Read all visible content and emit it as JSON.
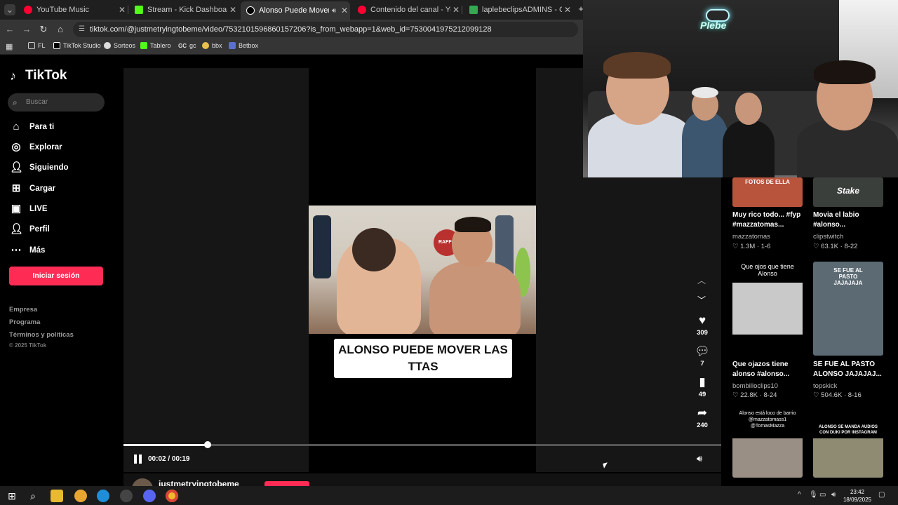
{
  "browser": {
    "tabs": [
      {
        "title": "YouTube Music",
        "color": "#ff0033"
      },
      {
        "title": "Stream - Kick Dashboard",
        "color": "#53fc18"
      },
      {
        "title": "Alonso Puede Mover Las Tt",
        "color": "#ffffff"
      },
      {
        "title": "Contenido del canal - YouTube",
        "color": "#ff0033"
      },
      {
        "title": "laplebeclipsADMINS - Google",
        "color": "#34a853"
      }
    ],
    "url": "tiktok.com/@justmetryingtobeme/video/7532101596860157206?is_from_webapp=1&web_id=7530041975212099128",
    "bookmarks": [
      "FL",
      "TikTok Studio",
      "Sorteos",
      "Tablero",
      "gc",
      "bbx",
      "Betbox"
    ]
  },
  "sidebar": {
    "logo": "TikTok",
    "search_placeholder": "Buscar",
    "nav": [
      {
        "label": "Para ti",
        "icon": "home-icon"
      },
      {
        "label": "Explorar",
        "icon": "compass-icon"
      },
      {
        "label": "Siguiendo",
        "icon": "user-follow-icon"
      },
      {
        "label": "Cargar",
        "icon": "upload-icon"
      },
      {
        "label": "LIVE",
        "icon": "live-icon"
      },
      {
        "label": "Perfil",
        "icon": "profile-icon"
      },
      {
        "label": "Más",
        "icon": "more-icon"
      }
    ],
    "login_label": "Iniciar sesión",
    "footer_links": [
      "Empresa",
      "Programa",
      "Términos y políticas"
    ],
    "copyright": "© 2025 TikTok"
  },
  "video": {
    "caption": "ALONSO PUEDE MOVER LAS TTAS",
    "poster_text": "RAFFO",
    "current_time": "00:02",
    "duration": "00:19",
    "progress": 0.1404,
    "likes": "309",
    "comments": "7",
    "saves": "49",
    "shares": "240",
    "author": "justmetryingtobeme"
  },
  "related": [
    {
      "overlay": "FOTOS DE ELLA",
      "title": "Muy rico todo... #fyp #mazzatomas...",
      "author": "mazzatomas",
      "views": "1.3M",
      "date": "1-6",
      "thumb": "#b8543c"
    },
    {
      "overlay": "Stake",
      "title": "Movia el labio #alonso...",
      "author": "clipstwitch",
      "views": "63.1K",
      "date": "8-22",
      "thumb": "#3b3f3c"
    },
    {
      "overlay": "Que ojos que tiene Alonso",
      "title": "Que ojazos tiene alonso #alonso...",
      "author": "bombilloclips10",
      "views": "22.8K",
      "date": "8-24",
      "thumb": "#c9c9c9"
    },
    {
      "overlay": "SE FUE AL PASTO JAJAJAJA",
      "title": "SE FUE AL PASTO ALONSO JAJAJAJ...",
      "author": "topskick",
      "views": "504.6K",
      "date": "8-16",
      "thumb": "#5c6a73"
    },
    {
      "overlay": "Alonso está loco de barrio @mazzatomass1 @TomasMazza",
      "title": "",
      "author": "",
      "views": "",
      "date": "",
      "thumb": "#9a8f84"
    },
    {
      "overlay": "ALONSO SE MANDA AUDIOS CON DUKI POR INSTAGRAM",
      "title": "",
      "author": "",
      "views": "",
      "date": "",
      "thumb": "#8f8a72"
    }
  ],
  "webcam": {
    "neon_sign": "Plebe"
  },
  "taskbar": {
    "time": "23:42",
    "date": "18/09/2025"
  }
}
